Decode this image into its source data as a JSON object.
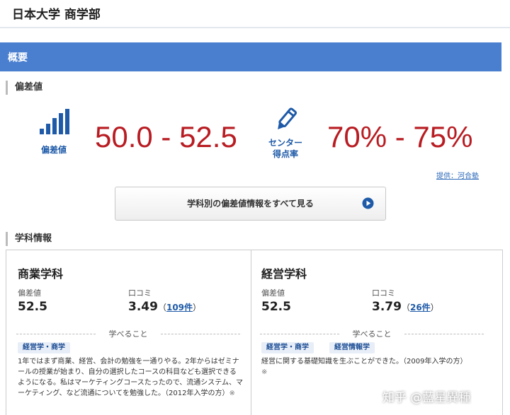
{
  "header": {
    "title": "日本大学 商学部"
  },
  "overview": {
    "title": "概要"
  },
  "hensachi": {
    "heading": "偏差値",
    "icon_label": "偏差値",
    "range": "50.0 - 52.5",
    "center_label_line1": "センター",
    "center_label_line2": "得点率",
    "center_range": "70% - 75%",
    "source": "提供：河合塾",
    "view_all_button": "学科別の偏差値情報をすべて見る"
  },
  "departments": {
    "heading": "学科情報",
    "items": [
      {
        "name": "商業学科",
        "hensachi_label": "偏差値",
        "hensachi": "52.5",
        "review_label": "口コミ",
        "review_score": "3.49",
        "review_count": "109件",
        "learn_label": "学べること",
        "tags": [
          "経営学・商学"
        ],
        "review_text": "1年ではまず商業、経営、会計の勉強を一通りやる。2年からはゼミナールの授業が始まり、自分の選択したコースの科目なども選択できるようになる。私はマーケティングコースたったので、流通システム、マーケティング、など流通についてを勉強した。（2012年入学の方）",
        "note": "※"
      },
      {
        "name": "経営学科",
        "hensachi_label": "偏差値",
        "hensachi": "52.5",
        "review_label": "口コミ",
        "review_score": "3.79",
        "review_count": "26件",
        "learn_label": "学べること",
        "tags": [
          "経営学・商学",
          "経営情報学"
        ],
        "review_text": "経営に関する基礎知識を生ぶことができた。（2009年入学の方）",
        "note": "※"
      }
    ]
  },
  "watermark": "知乎 @藍星異種",
  "colors": {
    "accent": "#4a7fd0",
    "value_red": "#b81c22",
    "link_blue": "#1e5aa8"
  },
  "icons": [
    "bar-chart-icon",
    "pencil-icon",
    "play-circle-icon"
  ]
}
